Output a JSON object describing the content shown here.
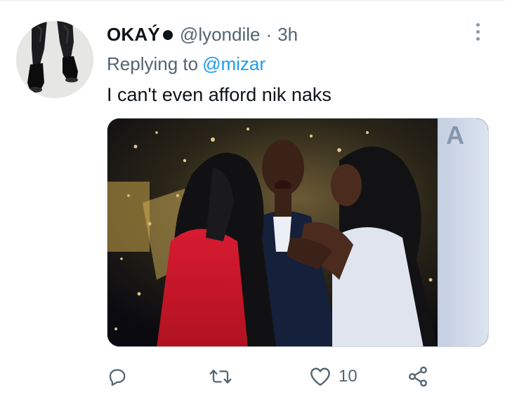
{
  "tweet": {
    "display_name": "OKAÝ",
    "handle": "@lyondile",
    "separator": "·",
    "time": "3h",
    "replying_prefix": "Replying to",
    "replying_to": "@mizar",
    "text": "I can't even afford nik naks",
    "media": {
      "image": "photo of a crying man embraced by two women on a sparkling stage",
      "backdrop_letters": "A"
    }
  },
  "actions": {
    "reply": {
      "icon": "reply-icon",
      "count": ""
    },
    "retweet": {
      "icon": "retweet-icon",
      "count": ""
    },
    "like": {
      "icon": "heart-icon",
      "count": "10"
    },
    "share": {
      "icon": "share-icon",
      "count": ""
    }
  },
  "colors": {
    "text_primary": "#0f1419",
    "text_secondary": "#536471",
    "link": "#1d9bf0",
    "divider": "#e7e9ea"
  }
}
